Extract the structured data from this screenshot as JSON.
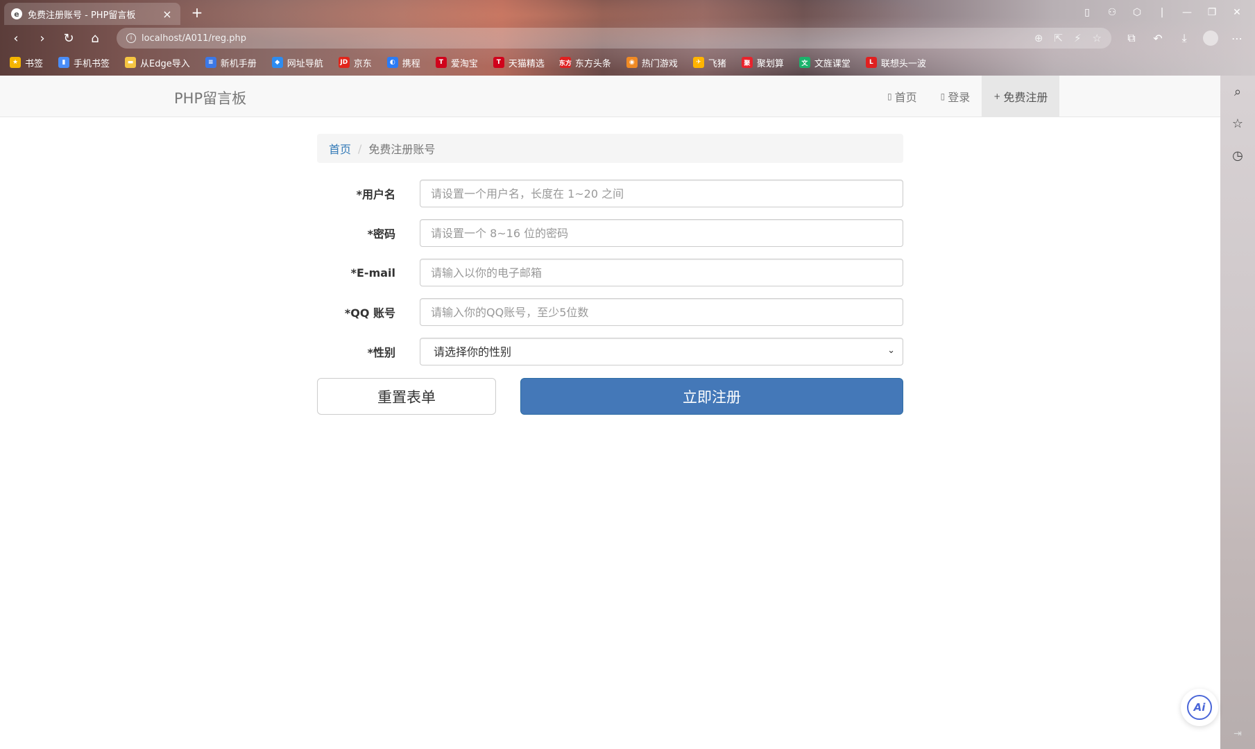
{
  "browser": {
    "tab_title": "免费注册账号 - PHP留言板",
    "tab_favicon": "e",
    "tab_close": "×",
    "new_tab": "+",
    "url": "localhost/A011/reg.php",
    "window_controls": [
      "▯",
      "⚇",
      "⬡",
      "|",
      "—",
      "❐",
      "✕"
    ],
    "nav_buttons": [
      "‹",
      "›",
      "↻",
      "⌂"
    ],
    "address_icons": [
      "⊕",
      "⇱",
      "⚡",
      "☆"
    ],
    "toolbar_icons": [
      "⧉",
      "↶",
      "⤓"
    ],
    "menu_icon": "⋯",
    "bookmarks": [
      {
        "label": "书签",
        "icon": "★",
        "color": "#f4b400"
      },
      {
        "label": "手机书签",
        "icon": "▮",
        "color": "#4a8df8"
      },
      {
        "label": "从Edge导入",
        "icon": "▬",
        "color": "#f5c542"
      },
      {
        "label": "新机手册",
        "icon": "≡",
        "color": "#3b78e7"
      },
      {
        "label": "网址导航",
        "icon": "◆",
        "color": "#2d8cf0"
      },
      {
        "label": "京东",
        "icon": "JD",
        "color": "#e1251b"
      },
      {
        "label": "携程",
        "icon": "◐",
        "color": "#2b7cf6"
      },
      {
        "label": "爱淘宝",
        "icon": "T",
        "color": "#d0021b"
      },
      {
        "label": "天猫精选",
        "icon": "T",
        "color": "#d0021b"
      },
      {
        "label": "东方头条",
        "icon": "东方",
        "color": "#e02020"
      },
      {
        "label": "热门游戏",
        "icon": "◉",
        "color": "#f08a24"
      },
      {
        "label": "飞猪",
        "icon": "✈",
        "color": "#ffb400"
      },
      {
        "label": "聚划算",
        "icon": "聚",
        "color": "#e8232c"
      },
      {
        "label": "文旌课堂",
        "icon": "文",
        "color": "#1bb36c"
      },
      {
        "label": "联想头一波",
        "icon": "L",
        "color": "#e02020"
      }
    ],
    "sidebar_icons": [
      "⌕",
      "☆",
      "◷"
    ],
    "sidebar_bottom": "⇥"
  },
  "site": {
    "brand": "PHP留言板",
    "menu": [
      {
        "icon": "▯",
        "label": "首页",
        "active": false
      },
      {
        "icon": "▯",
        "label": "登录",
        "active": false
      },
      {
        "icon": "+",
        "label": "免费注册",
        "active": true
      }
    ]
  },
  "breadcrumb": {
    "home": "首页",
    "sep": "/",
    "current": "免费注册账号"
  },
  "form": {
    "username": {
      "label": "*用户名",
      "placeholder": "请设置一个用户名，长度在 1~20 之间"
    },
    "password": {
      "label": "*密码",
      "placeholder": "请设置一个 8~16 位的密码"
    },
    "email": {
      "label": "*E-mail",
      "placeholder": "请输入以你的电子邮箱"
    },
    "qq": {
      "label": "*QQ 账号",
      "placeholder": "请输入你的QQ账号，至少5位数"
    },
    "gender": {
      "label": "*性别",
      "selected": "请选择你的性别",
      "chevron": "⌄"
    },
    "reset_label": "重置表单",
    "submit_label": "立即注册"
  },
  "ai_button": "Ai"
}
